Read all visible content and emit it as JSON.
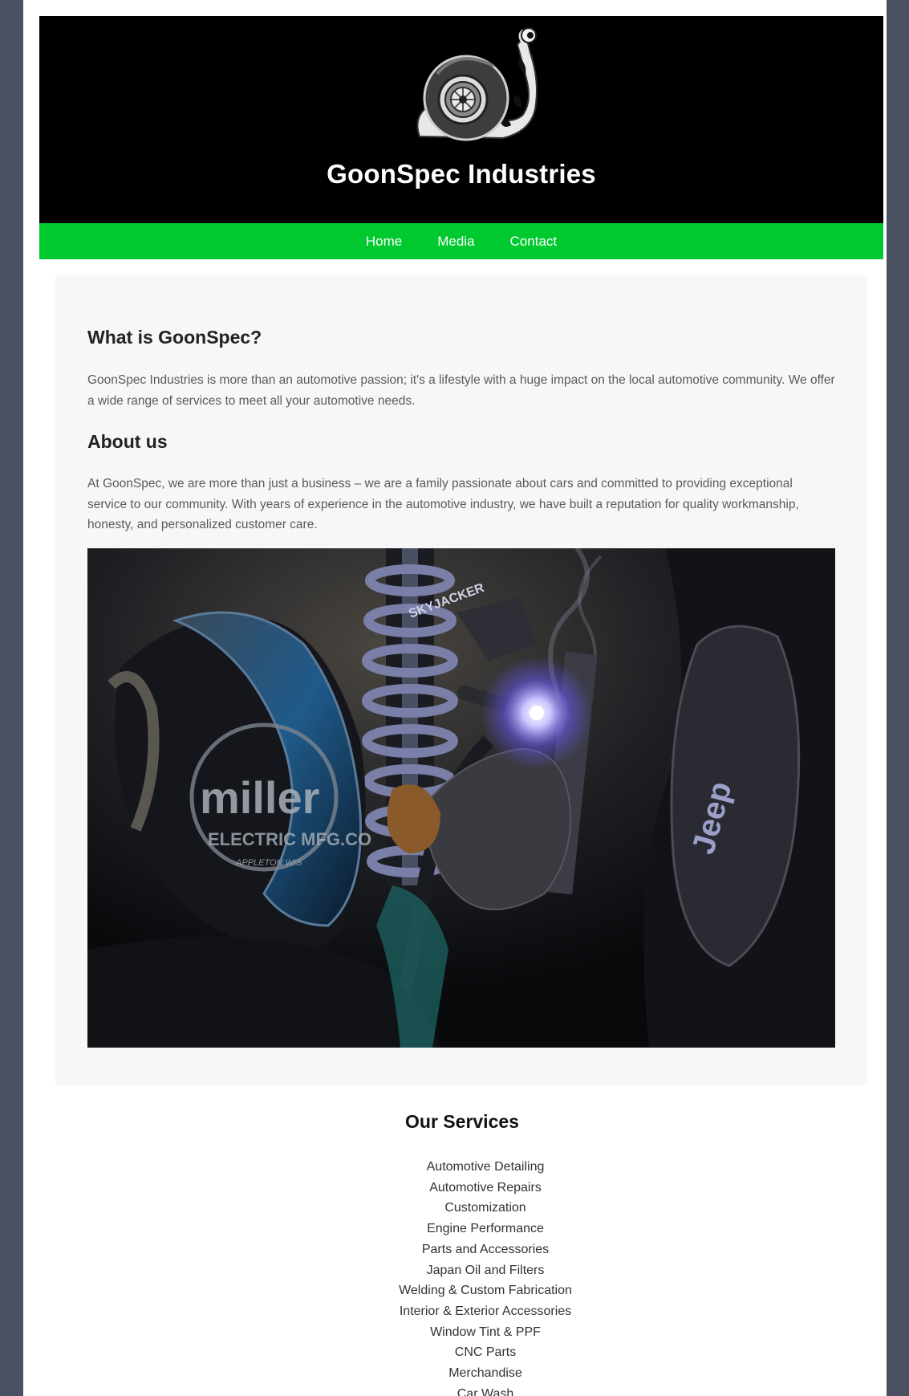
{
  "header": {
    "logo_icon": "turbo-snail-logo-icon",
    "title": "GoonSpec Industries"
  },
  "nav": {
    "items": [
      {
        "label": "Home"
      },
      {
        "label": "Media"
      },
      {
        "label": "Contact"
      }
    ]
  },
  "main": {
    "what": {
      "heading": "What is GoonSpec?",
      "text": "GoonSpec Industries is more than an automotive passion; it's a lifestyle with a huge impact on the local automotive community. We offer a wide range of services to meet all your automotive needs."
    },
    "about": {
      "heading": "About us",
      "text": "At GoonSpec, we are more than just a business – we are a family passionate about cars and committed to providing exceptional service to our community. With years of experience in the automotive industry, we have built a reputation for quality workmanship, honesty, and personalized customer care."
    },
    "photo": {
      "helmet_brand": "miller",
      "helmet_sub": "ELECTRIC MFG.CO",
      "helmet_city": "APPLETON WIS",
      "shock_brand": "SKYJACKER",
      "car_brand": "Jeep"
    }
  },
  "services": {
    "title": "Our Services",
    "items": [
      "Automotive Detailing",
      "Automotive Repairs",
      "Customization",
      "Engine Performance",
      "Parts and Accessories",
      "Japan Oil and Filters",
      "Welding & Custom Fabrication",
      "Interior & Exterior Accessories",
      "Window Tint & PPF",
      "CNC Parts",
      "Merchandise",
      "Car Wash"
    ]
  },
  "colors": {
    "nav_green": "#00c92f",
    "header_black": "#000000",
    "outer_background": "#4a5160"
  }
}
